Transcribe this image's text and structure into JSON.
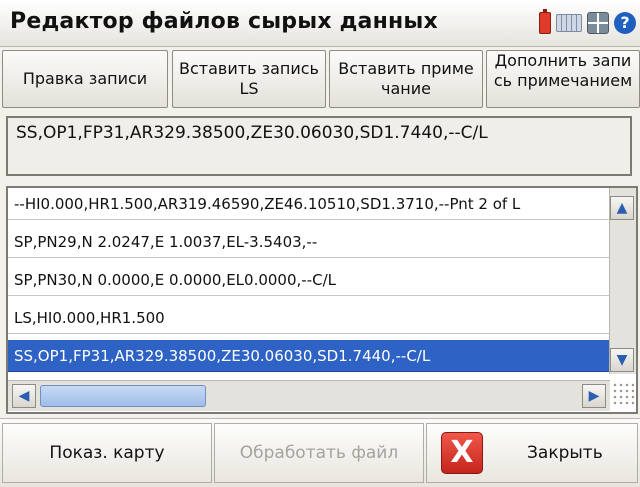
{
  "window": {
    "title": "Редактор файлов сырых данных"
  },
  "tray_icons": [
    "battery-icon",
    "keyboard-icon",
    "grid-icon",
    "help-icon"
  ],
  "help_glyph": "?",
  "toolbar": {
    "buttons": [
      {
        "label": "Правка записи"
      },
      {
        "label": "Вставить запись LS"
      },
      {
        "label": "Вставить примечание"
      },
      {
        "label": "Дополнить запись примечанием"
      }
    ]
  },
  "editor": {
    "value": "SS,OP1,FP31,AR329.38500,ZE30.06030,SD1.7440,--C/L"
  },
  "records": [
    {
      "text": "--HI0.000,HR1.500,AR319.46590,ZE46.10510,SD1.3710,--Pnt 2 of L",
      "selected": false
    },
    {
      "text": "SP,PN29,N 2.0247,E 1.0037,EL-3.5403,--",
      "selected": false
    },
    {
      "text": "SP,PN30,N 0.0000,E 0.0000,EL0.0000,--C/L",
      "selected": false
    },
    {
      "text": "LS,HI0.000,HR1.500",
      "selected": false
    },
    {
      "text": "SS,OP1,FP31,AR329.38500,ZE30.06030,SD1.7440,--C/L",
      "selected": true
    }
  ],
  "bottom": {
    "show_map": "Показ. карту",
    "process_file": "Обработать файл",
    "close": "Закрыть",
    "close_glyph": "X"
  },
  "colors": {
    "selection": "#2f62c5",
    "close_icon": "#d7352a"
  }
}
